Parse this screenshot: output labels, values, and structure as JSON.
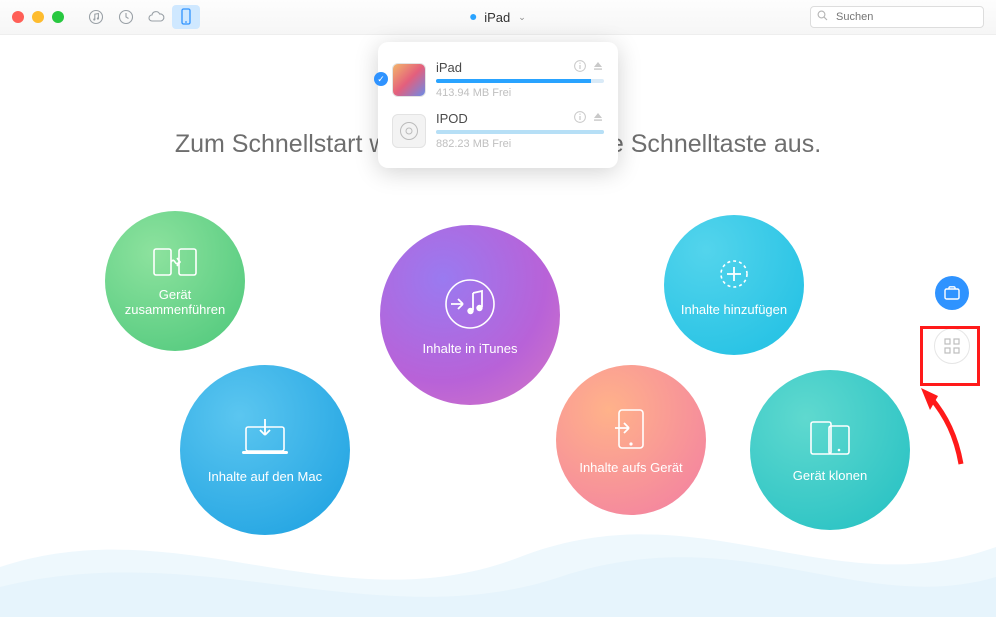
{
  "header": {
    "device_label": "iPad",
    "search_placeholder": "Suchen"
  },
  "dropdown": {
    "items": [
      {
        "name": "iPad",
        "free_text": "413.94 MB Frei",
        "bar_pct": 92,
        "selected": true,
        "kind": "ios"
      },
      {
        "name": "IPOD",
        "free_text": "882.23 MB Frei",
        "bar_pct": 100,
        "selected": false,
        "kind": "ipod"
      }
    ]
  },
  "tagline": {
    "prefix": "Zum Schnellstart w",
    "suffix": "e Schnelltaste aus."
  },
  "bubbles": {
    "merge": {
      "line1": "Gerät",
      "line2": "zusammenführen"
    },
    "mac": {
      "label": "Inhalte auf den Mac"
    },
    "itunes": {
      "label": "Inhalte in iTunes"
    },
    "device": {
      "label": "Inhalte aufs Gerät"
    },
    "add": {
      "label": "Inhalte hinzufügen"
    },
    "clone": {
      "label": "Gerät klonen"
    }
  }
}
